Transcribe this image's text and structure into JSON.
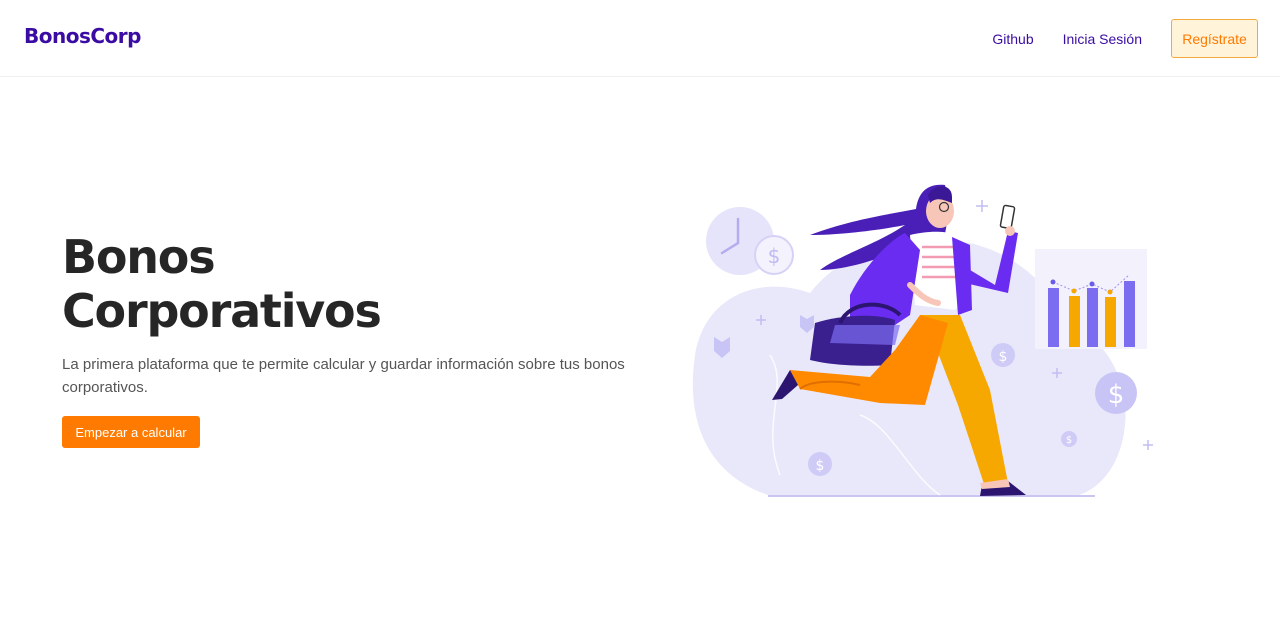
{
  "nav": {
    "brand": "BonosCorp",
    "links": [
      "Github",
      "Inicia Sesión"
    ],
    "register_label": "Regístrate"
  },
  "hero": {
    "title_line1": "Bonos",
    "title_line2": "Corporativos",
    "description": "La primera plataforma que te permite calcular y guardar información sobre tus bonos corporativos.",
    "cta_label": "Empezar a calcular"
  },
  "colors": {
    "brand": "#3a0ca3",
    "accent": "#ff7a00",
    "register_bg": "#fff3d9",
    "illustration_purple": "#6a2cf0",
    "illustration_yellow": "#f7a800"
  },
  "icons": [
    "clock-icon",
    "dollar-coin-icon",
    "bar-chart-icon",
    "phone-icon",
    "bag-icon"
  ]
}
